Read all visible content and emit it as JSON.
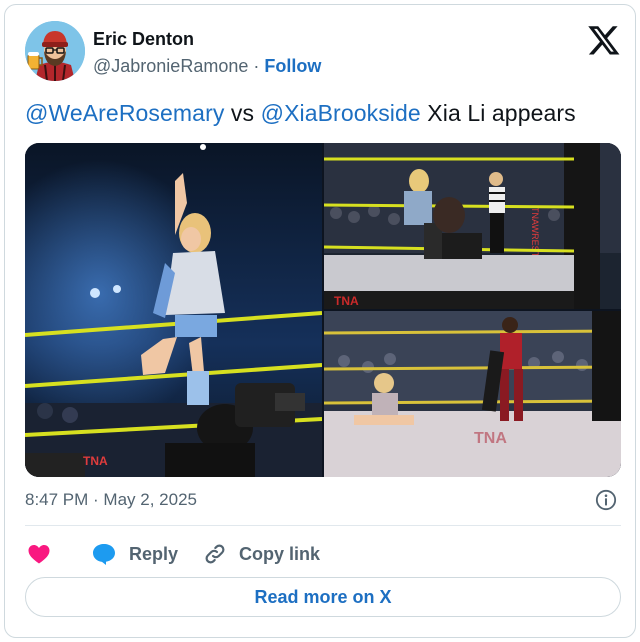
{
  "author": {
    "name": "Eric Denton",
    "handle": "@JabronieRamone",
    "separator": "·",
    "follow_label": "Follow"
  },
  "tweet": {
    "mention_1": "@WeAreRosemary",
    "vs_text": " vs ",
    "mention_2": "@XiaBrookside",
    "tail_text": " Xia Li appears"
  },
  "photos": [
    {
      "icon": "wrestler-celebrating-photo"
    },
    {
      "icon": "wrestlers-in-ring-photo"
    },
    {
      "icon": "wrestler-standing-over-opponent-photo"
    }
  ],
  "meta": {
    "timestamp": "8:47 PM · May 2, 2025"
  },
  "actions": {
    "like_icon": "heart-icon",
    "reply_label": "Reply",
    "copy_label": "Copy link"
  },
  "read_more_label": "Read more on X",
  "colors": {
    "accent_blue": "#1d6fc2",
    "like_pink": "#f91880",
    "muted_text": "#536471",
    "border": "#cfd9de"
  }
}
